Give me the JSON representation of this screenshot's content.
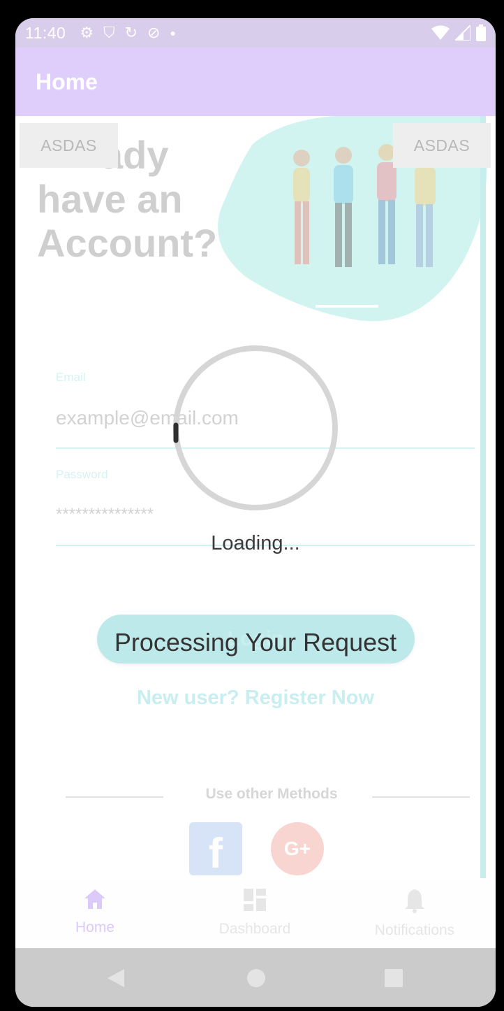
{
  "status_bar": {
    "time": "11:40",
    "icons": [
      "settings-icon",
      "shield-icon",
      "sync-icon",
      "no-sim-icon",
      "dot-icon"
    ],
    "right_icons": [
      "wifi-icon",
      "signal-icon",
      "battery-icon"
    ]
  },
  "app_bar": {
    "title": "Home"
  },
  "tabs": {
    "left_label": "ASDAS",
    "right_label": "ASDAS"
  },
  "login_screen": {
    "heading_line_1": "ady",
    "heading_line_2": "have an",
    "heading_line_3": "Account?",
    "email_label": "Email",
    "email_placeholder": "example@email.com",
    "password_label": "Password",
    "password_value": "***************",
    "login_button": "Login",
    "register_link": "New user? Register Now",
    "other_methods": "Use other Methods"
  },
  "overlay": {
    "loading_text": "Loading...",
    "processing_text": "Processing Your Request"
  },
  "bottom_nav": {
    "items": [
      {
        "label": "Home",
        "icon": "home-icon",
        "active": true
      },
      {
        "label": "Dashboard",
        "icon": "dashboard-icon",
        "active": false
      },
      {
        "label": "Notifications",
        "icon": "bell-icon",
        "active": false
      }
    ]
  },
  "colors": {
    "app_bar": "#dfcdfb",
    "accent": "#bde9ea",
    "active_nav": "#dccafb"
  }
}
